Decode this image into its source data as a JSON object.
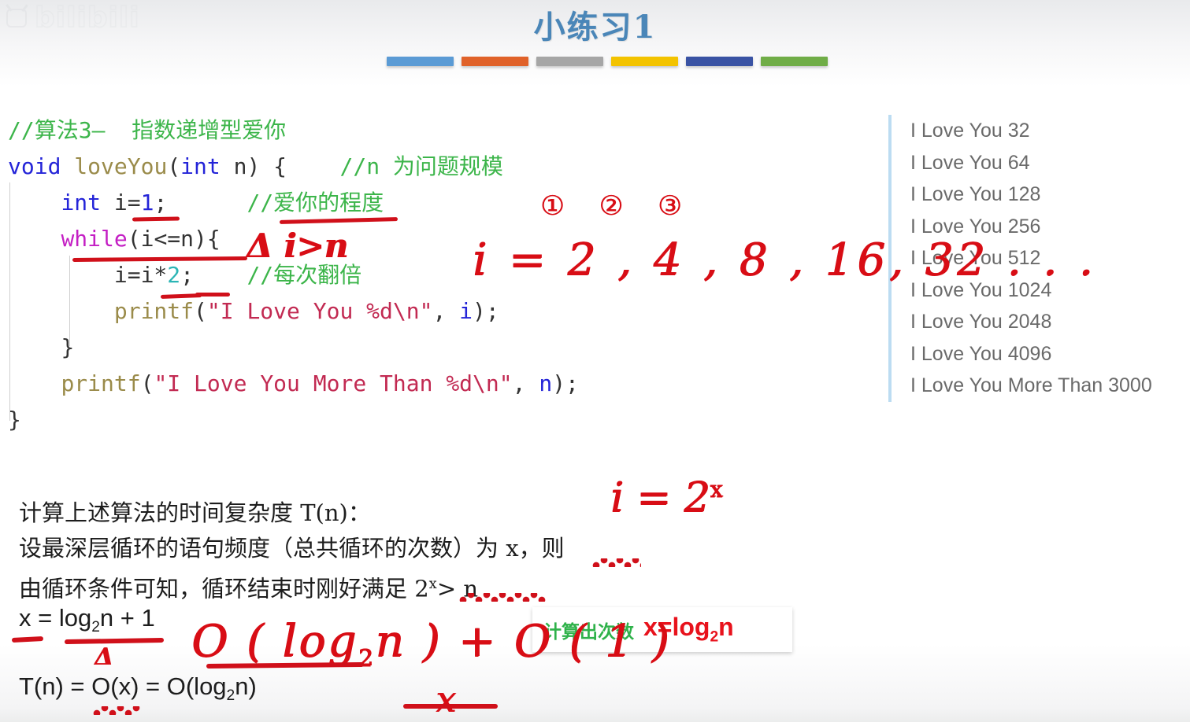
{
  "slide": {
    "title": "小练习1",
    "watermark": "bilibili",
    "bar_colors": [
      "#5b9bd5",
      "#e0622a",
      "#a6a6a6",
      "#f3c300",
      "#3a53a4",
      "#70ad47"
    ],
    "title_color": "#4a86b8"
  },
  "code": {
    "lines": [
      {
        "id": "c1",
        "text": "//算法3—  指数递增型爱你"
      },
      {
        "id": "c2",
        "text": "void loveYou(int n) {    //n 为问题规模"
      },
      {
        "id": "c3",
        "text": "    int i=1;      //爱你的程度"
      },
      {
        "id": "c4",
        "text": "    while(i<=n){"
      },
      {
        "id": "c5",
        "text": "        i=i*2;    //每次翻倍"
      },
      {
        "id": "c6",
        "text": "        printf(\"I Love You %d\\n\", i);"
      },
      {
        "id": "c7",
        "text": "    }"
      },
      {
        "id": "c8",
        "text": "    printf(\"I Love You More Than %d\\n\", n);"
      },
      {
        "id": "c9",
        "text": "}"
      }
    ],
    "tokens": {
      "comment_1": "//算法3—  指数递增型爱你",
      "kw_void": "void",
      "fn_loveyou": "loveYou",
      "kw_int_param": "int",
      "param_n": "n",
      "comment_n": "//n 为问题规模",
      "kw_int_decl": "int",
      "var_i": "i=",
      "num_1": "1",
      "comment_degree": "//爱你的程度",
      "kw_while": "while",
      "while_cond": "(i<=n){",
      "stmt_double": "i=i*2;",
      "num_2": "2",
      "comment_double": "//每次翻倍",
      "fn_printf": "printf",
      "str_love": "\"I Love You %d\\n\"",
      "arg_i": "i",
      "str_love_more": "\"I Love You More Than %d\\n\"",
      "arg_n": "n",
      "brace_close_inner": "}",
      "brace_close_outer": "}"
    }
  },
  "output": {
    "lines": [
      "I Love You 32",
      "I Love You 64",
      "I Love You 128",
      "I Love You 256",
      "I Love You 512",
      "I Love You 1024",
      "I Love You 2048",
      "I Love You 4096",
      "I Love You More Than 3000"
    ]
  },
  "analysis": {
    "line1": "计算上述算法的时间复杂度 T(n)：",
    "line2": "设最深层循环的语句频度（总共循环的次数）为 x，则",
    "line3_a": "由循环条件可知，循环结束时刚好满足 2",
    "line3_sup": "x",
    "line3_b": "> n",
    "formula1_a": "x = log",
    "formula1_sub": "2",
    "formula1_b": "n + 1",
    "formula2_a": "T(n) = O(x) = O(log",
    "formula2_sub": "2",
    "formula2_b": "n)"
  },
  "callout": {
    "label": "计算出次数",
    "formula_a": "x=log",
    "formula_sub": "2",
    "formula_b": "n"
  },
  "handwriting": {
    "sequence": "i = 2 , 4 , 8 , 16, 32 . . .",
    "circled": "①②③",
    "loop_exit": "Δ i>n",
    "power_a": "i = 2",
    "power_sup": "x",
    "big_o_a": "O ( log",
    "big_o_sub": "2",
    "big_o_b": "n ) + O ( 1 )",
    "x_mark": "x"
  }
}
